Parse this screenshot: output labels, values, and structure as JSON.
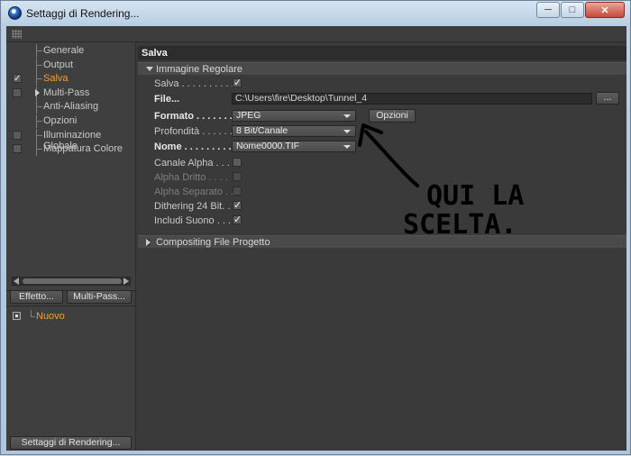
{
  "window": {
    "title": "Settaggi di Rendering...",
    "minimize_label": "─",
    "maximize_label": "□",
    "close_label": "✕"
  },
  "sidebar": {
    "items": [
      {
        "label": "Generale",
        "checkbox": false,
        "checked": false,
        "active": false,
        "expandable": false
      },
      {
        "label": "Output",
        "checkbox": false,
        "checked": false,
        "active": false,
        "expandable": false
      },
      {
        "label": "Salva",
        "checkbox": true,
        "checked": true,
        "active": true,
        "expandable": false
      },
      {
        "label": "Multi-Pass",
        "checkbox": true,
        "checked": false,
        "active": false,
        "expandable": true
      },
      {
        "label": "Anti-Aliasing",
        "checkbox": false,
        "checked": false,
        "active": false,
        "expandable": false
      },
      {
        "label": "Opzioni",
        "checkbox": false,
        "checked": false,
        "active": false,
        "expandable": false
      },
      {
        "label": "Illuminazione Globale",
        "checkbox": true,
        "checked": false,
        "active": false,
        "expandable": false
      },
      {
        "label": "Mappatura Colore",
        "checkbox": true,
        "checked": false,
        "active": false,
        "expandable": false
      }
    ],
    "effetto_button": "Effetto...",
    "multipass_button": "Multi-Pass...",
    "preset_label": "Nuovo",
    "settings_button": "Settaggi di Rendering..."
  },
  "main": {
    "section_title": "Salva",
    "group_regular": "Immagine Regolare",
    "group_compositing": "Compositing File Progetto",
    "rows": {
      "salva": {
        "label": "Salva . . . . . . . . . .",
        "checked": true
      },
      "file": {
        "label": "File...",
        "value": "C:\\Users\\fire\\Desktop\\Tunnel_4",
        "browse": "..."
      },
      "formato": {
        "label": "Formato . . . . . . .",
        "value": "JPEG",
        "options_button": "Opzioni"
      },
      "profondita": {
        "label": "Profondità . . . . . .",
        "value": "8 Bit/Canale"
      },
      "nome": {
        "label": "Nome . . . . . . . . .",
        "value": "Nome0000.TIF"
      },
      "canale_alpha": {
        "label": "Canale Alpha . . . .",
        "checked": false
      },
      "alpha_dritto": {
        "label": "Alpha Dritto . . . .",
        "checked": false
      },
      "alpha_separato": {
        "label": "Alpha Separato . .",
        "checked": false
      },
      "dithering": {
        "label": "Dithering 24 Bit. . .",
        "checked": true
      },
      "includi_suono": {
        "label": "Includi Suono . . . .",
        "checked": true
      }
    }
  },
  "annotation": {
    "line1": "QUI LA",
    "line2": "SCELTA."
  },
  "colors": {
    "panel_bg": "#3a3a3a",
    "active_item": "#f0a030",
    "annotation_ink": "#000000"
  }
}
